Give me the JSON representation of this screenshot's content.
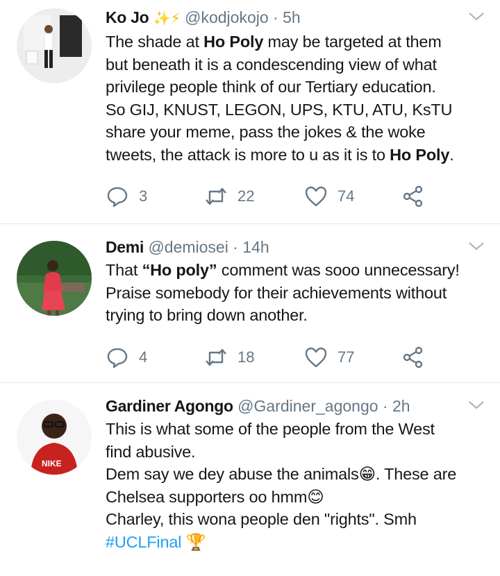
{
  "tweets": [
    {
      "name": "Ko Jo",
      "name_emojis": "✨⚡",
      "handle": "@kodjokojo",
      "dot": "·",
      "time": "5h",
      "lines": [
        [
          "The shade at ",
          {
            "b": "Ho Poly"
          },
          " may be targeted at them"
        ],
        [
          "but beneath it is a condescending view of what"
        ],
        [
          "privilege people think of our Tertiary education."
        ],
        [
          "So GIJ, KNUST, LEGON, UPS, KTU, ATU, KsTU"
        ],
        [
          "share your meme, pass the jokes & the woke"
        ],
        [
          "tweets, the attack is more to u as it is to ",
          {
            "b": "Ho Poly"
          },
          "."
        ]
      ],
      "replies": "3",
      "retweets": "22",
      "likes": "74"
    },
    {
      "name": "Demi",
      "handle": "@demiosei",
      "dot": "·",
      "time": "14h",
      "lines": [
        [
          "That ",
          {
            "b": "“Ho poly”"
          },
          " comment was sooo unnecessary!"
        ],
        [
          "Praise somebody for their achievements without"
        ],
        [
          "trying to bring down another."
        ]
      ],
      "replies": "4",
      "retweets": "18",
      "likes": "77"
    },
    {
      "name": "Gardiner Agongo",
      "handle": "@Gardiner_agongo",
      "dot": "·",
      "time": "2h",
      "lines": [
        [
          "This is what some of the people from the West"
        ],
        [
          "find abusive."
        ],
        [
          "Dem say we dey abuse the animals😁. These are"
        ],
        [
          "Chelsea supporters oo hmm😊"
        ],
        [
          "Charley, this wona people den  \"rights\". Smh"
        ],
        [
          {
            "h": "#UCLFinal"
          },
          " 🏆"
        ]
      ]
    }
  ]
}
